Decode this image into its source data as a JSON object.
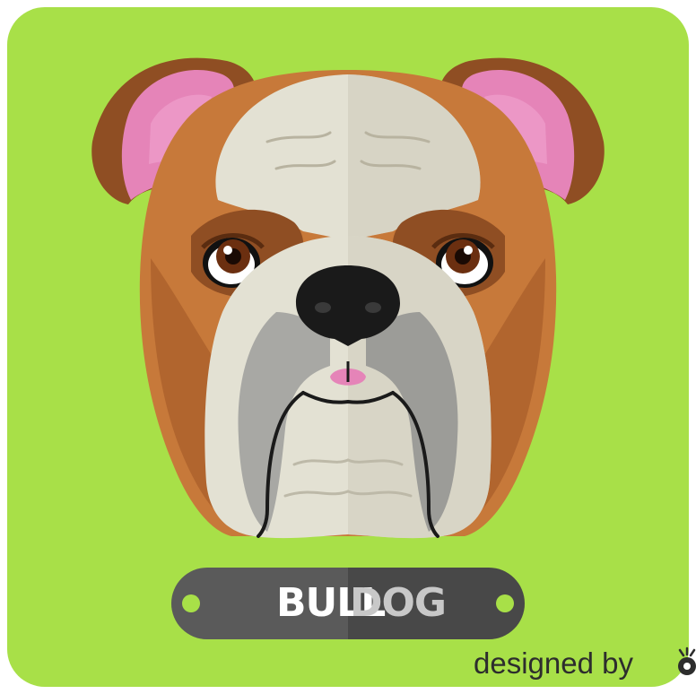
{
  "image": {
    "background_color": "#a8e048",
    "subject": "bulldog-face-illustration"
  },
  "nameplate": {
    "text_primary": "BULL",
    "text_secondary": "DOG"
  },
  "credit": {
    "text": "designed by",
    "logo_icon": "freepik-logo-icon"
  },
  "colors": {
    "green_background": "#a8e048",
    "fur_orange": "#c7793a",
    "fur_cream": "#e3e1d3",
    "ear_pink": "#e584b8",
    "plate_dark": "#484848",
    "plate_light": "#5a5a5a"
  }
}
